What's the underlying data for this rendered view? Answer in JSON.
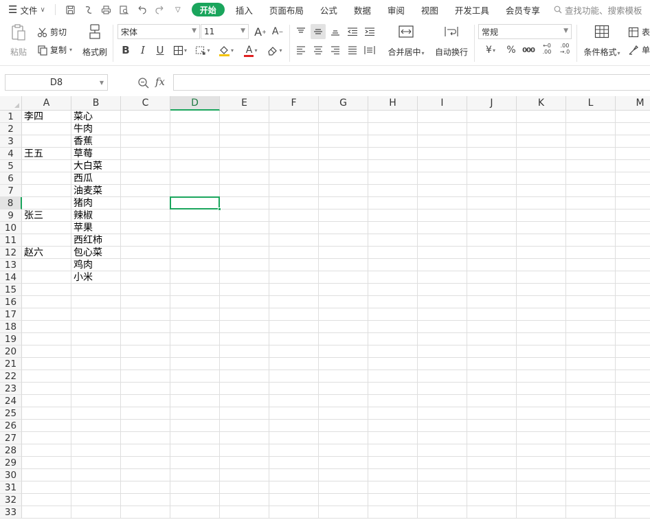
{
  "menubar": {
    "file_label": "文件",
    "tabs": [
      "开始",
      "插入",
      "页面布局",
      "公式",
      "数据",
      "审阅",
      "视图",
      "开发工具",
      "会员专享"
    ],
    "active_tab_index": 0,
    "search_label": "查找功能、搜索模板"
  },
  "ribbon": {
    "paste_label": "粘贴",
    "cut_label": "剪切",
    "copy_label": "复制",
    "format_painter_label": "格式刷",
    "font_name": "宋体",
    "font_size": "11",
    "merge_label": "合并居中",
    "wrap_label": "自动换行",
    "number_format": "常规",
    "conditional_format_label": "条件格式",
    "table_label": "表",
    "single_label": "单",
    "currency_symbol": "¥",
    "percent_symbol": "%",
    "thousands_symbol": "000",
    "inc_decimal_top": "←0",
    "inc_decimal_bottom": ".00",
    "dec_decimal_top": ".00",
    "dec_decimal_bottom": "→.0",
    "bold": "B",
    "italic": "I",
    "underline": "U",
    "font_color_letter": "A",
    "grow_font": "A",
    "shrink_font": "A",
    "colors": {
      "fill_color": "#f4c400",
      "font_color": "#e02020",
      "accent": "#1aa55c"
    }
  },
  "formula_bar": {
    "name_box": "D8",
    "fx_label": "fx",
    "formula": ""
  },
  "sheet": {
    "columns": [
      "A",
      "B",
      "C",
      "D",
      "E",
      "F",
      "G",
      "H",
      "I",
      "J",
      "K",
      "L",
      "M"
    ],
    "selected_column": "D",
    "selected_row": 8,
    "row_count": 33,
    "cells": {
      "A": [
        "李四",
        "",
        "",
        "王五",
        "",
        "",
        "",
        "",
        "张三",
        "",
        "",
        "赵六",
        "",
        ""
      ],
      "B": [
        "菜心",
        "牛肉",
        "香蕉",
        "草莓",
        "大白菜",
        "西瓜",
        "油麦菜",
        "猪肉",
        "辣椒",
        "苹果",
        "西红柿",
        "包心菜",
        "鸡肉",
        "小米"
      ]
    }
  }
}
